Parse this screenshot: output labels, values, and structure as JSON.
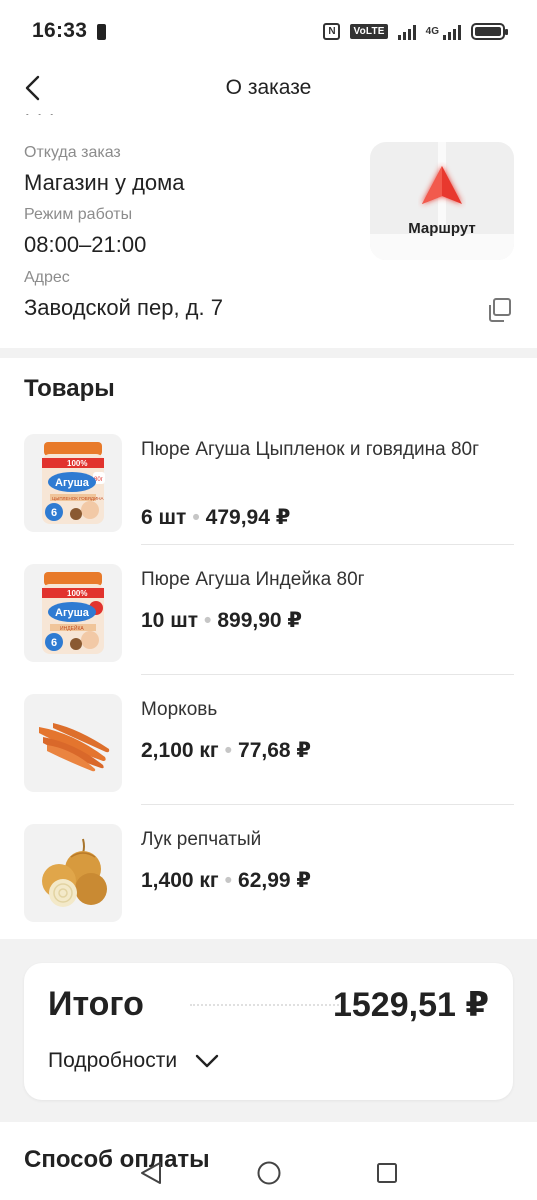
{
  "status_bar": {
    "time": "16:33",
    "network": "4G",
    "volte": "VoLTE",
    "nfc": "N"
  },
  "header": {
    "title": "О заказе",
    "back_icon": "chevron-left-icon"
  },
  "store": {
    "cut_text": "· · ·",
    "source_label": "Откуда заказ",
    "source_value": "Магазин у дома",
    "hours_label": "Режим работы",
    "hours_value": "08:00–21:00",
    "address_label": "Адрес",
    "address_value": "Заводской пер, д. 7",
    "route_label": "Маршрут",
    "route_icon": "navigation-arrow-icon",
    "copy_icon": "copy-icon"
  },
  "products": {
    "title": "Товары",
    "items": [
      {
        "name": "Пюре Агуша Цыпленок и говядина 80г",
        "quantity": "6 шт",
        "price": "479,94 ₽",
        "image": "baby-puree-jar",
        "jar_brand": "Агуша",
        "jar_badge": "100%",
        "jar_age": "6",
        "jar_weight": "80г",
        "jar_flavor": "ЦЫПЛЕНОК ГОВЯДИНА"
      },
      {
        "name": "Пюре Агуша Индейка 80г",
        "quantity": "10 шт",
        "price": "899,90 ₽",
        "image": "baby-puree-jar",
        "jar_brand": "Агуша",
        "jar_badge": "100%",
        "jar_age": "6",
        "jar_weight": "80г",
        "jar_flavor": "ИНДЕЙКА"
      },
      {
        "name": "Морковь",
        "quantity": "2,100 кг",
        "price": "77,68 ₽",
        "image": "carrots"
      },
      {
        "name": "Лук репчатый",
        "quantity": "1,400 кг",
        "price": "62,99 ₽",
        "image": "onions"
      }
    ]
  },
  "total": {
    "label": "Итого",
    "value": "1529,51 ₽",
    "details_label": "Подробности",
    "details_icon": "chevron-down-icon"
  },
  "payment": {
    "title": "Способ оплаты"
  },
  "nav_bar": {
    "back_icon": "triangle-back-icon",
    "home_icon": "circle-home-icon",
    "recents_icon": "square-recents-icon"
  },
  "colors": {
    "accent": "#e8392f",
    "text": "#222222",
    "secondary_text": "#8c8c8c",
    "section_bg": "#f2f2f2"
  }
}
